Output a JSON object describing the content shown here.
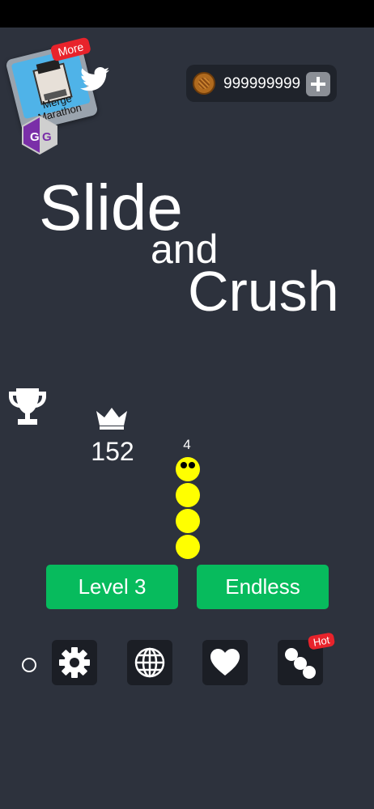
{
  "promo": {
    "badge": "More",
    "title": "Merge Marathon",
    "icon": "merge-marathon-app-icon"
  },
  "icons": {
    "gameguardian": "gameguardian-icon",
    "twitter": "twitter-icon",
    "coin": "coin-icon",
    "plus": "plus-icon",
    "trophy": "trophy-icon",
    "crown": "crown-icon",
    "settings": "gear-icon",
    "language": "globe-icon",
    "favorite": "heart-icon",
    "skins": "dots-icon"
  },
  "coins": {
    "value": "999999999"
  },
  "title": {
    "line1": "Slide",
    "line2": "and",
    "line3": "Crush"
  },
  "stats": {
    "best_score": "152",
    "snake_length": "4"
  },
  "buttons": {
    "level": "Level 3",
    "endless": "Endless"
  },
  "badges": {
    "hot": "Hot"
  },
  "colors": {
    "background": "#2d323d",
    "accent_green": "#07bb5d",
    "snake_yellow": "#ffff00",
    "badge_red": "#e8232b"
  }
}
